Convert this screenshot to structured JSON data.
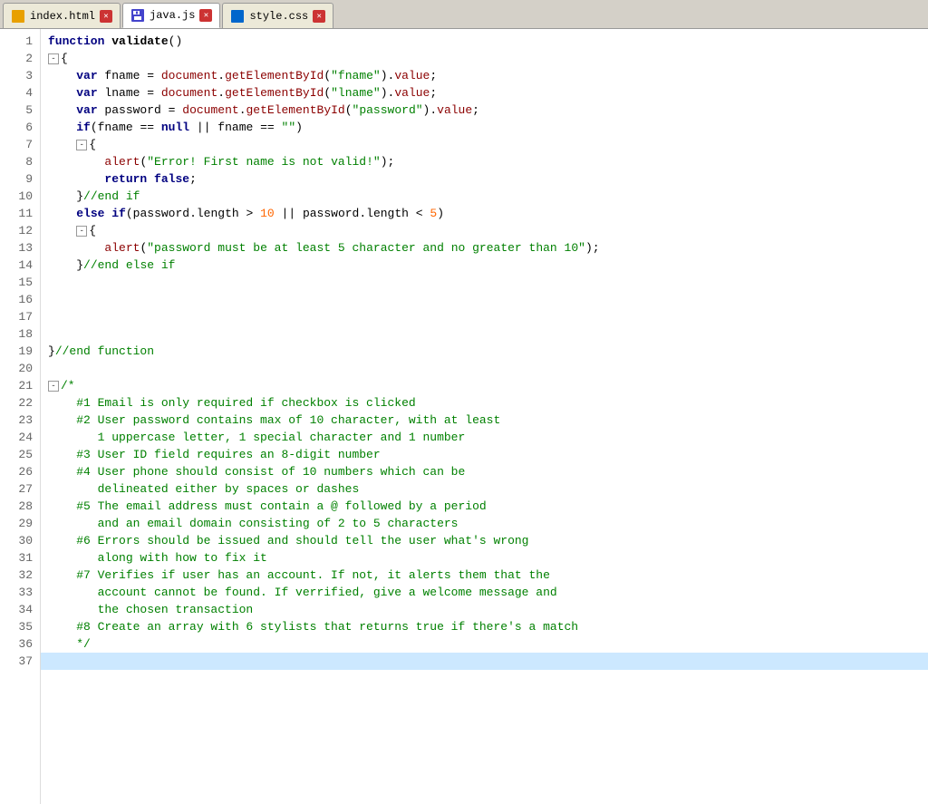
{
  "tabs": [
    {
      "id": "index-html",
      "label": "index.html",
      "icon": "html",
      "active": false,
      "modified": false
    },
    {
      "id": "java-js",
      "label": "java.js",
      "icon": "js",
      "active": true,
      "modified": true
    },
    {
      "id": "style-css",
      "label": "style.css",
      "icon": "css",
      "active": false,
      "modified": false
    }
  ],
  "lines": [
    {
      "num": 1,
      "indent": 0,
      "fold": null,
      "content": "function_validate_open"
    },
    {
      "num": 2,
      "indent": 0,
      "fold": "minus",
      "content": "open_brace"
    },
    {
      "num": 3,
      "indent": 2,
      "fold": null,
      "content": "var_fname"
    },
    {
      "num": 4,
      "indent": 2,
      "fold": null,
      "content": "var_lname"
    },
    {
      "num": 5,
      "indent": 2,
      "fold": null,
      "content": "var_password"
    },
    {
      "num": 6,
      "indent": 2,
      "fold": null,
      "content": "if_fname_null"
    },
    {
      "num": 7,
      "indent": 2,
      "fold": "minus",
      "content": "open_brace2"
    },
    {
      "num": 8,
      "indent": 3,
      "fold": null,
      "content": "alert_fname"
    },
    {
      "num": 9,
      "indent": 3,
      "fold": null,
      "content": "return_false"
    },
    {
      "num": 10,
      "indent": 2,
      "fold": null,
      "content": "close_end_if"
    },
    {
      "num": 11,
      "indent": 2,
      "fold": null,
      "content": "else_if_password"
    },
    {
      "num": 12,
      "indent": 2,
      "fold": "minus",
      "content": "open_brace3"
    },
    {
      "num": 13,
      "indent": 3,
      "fold": null,
      "content": "alert_password"
    },
    {
      "num": 14,
      "indent": 2,
      "fold": null,
      "content": "close_end_else_if"
    },
    {
      "num": 15,
      "indent": 0,
      "fold": null,
      "content": "empty"
    },
    {
      "num": 16,
      "indent": 0,
      "fold": null,
      "content": "empty"
    },
    {
      "num": 17,
      "indent": 0,
      "fold": null,
      "content": "empty"
    },
    {
      "num": 18,
      "indent": 0,
      "fold": null,
      "content": "empty"
    },
    {
      "num": 19,
      "indent": 0,
      "fold": null,
      "content": "close_end_function"
    },
    {
      "num": 20,
      "indent": 0,
      "fold": null,
      "content": "empty"
    },
    {
      "num": 21,
      "indent": 0,
      "fold": "minus",
      "content": "comment_open"
    },
    {
      "num": 22,
      "indent": 1,
      "fold": null,
      "content": "comment_1"
    },
    {
      "num": 23,
      "indent": 1,
      "fold": null,
      "content": "comment_2a"
    },
    {
      "num": 24,
      "indent": 2,
      "fold": null,
      "content": "comment_2b"
    },
    {
      "num": 25,
      "indent": 1,
      "fold": null,
      "content": "comment_3"
    },
    {
      "num": 26,
      "indent": 1,
      "fold": null,
      "content": "comment_4a"
    },
    {
      "num": 27,
      "indent": 2,
      "fold": null,
      "content": "comment_4b"
    },
    {
      "num": 28,
      "indent": 1,
      "fold": null,
      "content": "comment_5a"
    },
    {
      "num": 29,
      "indent": 2,
      "fold": null,
      "content": "comment_5b"
    },
    {
      "num": 30,
      "indent": 1,
      "fold": null,
      "content": "comment_6a"
    },
    {
      "num": 31,
      "indent": 2,
      "fold": null,
      "content": "comment_6b"
    },
    {
      "num": 32,
      "indent": 1,
      "fold": null,
      "content": "comment_7a"
    },
    {
      "num": 33,
      "indent": 2,
      "fold": null,
      "content": "comment_7b"
    },
    {
      "num": 34,
      "indent": 2,
      "fold": null,
      "content": "comment_7c"
    },
    {
      "num": 35,
      "indent": 1,
      "fold": null,
      "content": "comment_8"
    },
    {
      "num": 36,
      "indent": 0,
      "fold": null,
      "content": "comment_close"
    },
    {
      "num": 37,
      "indent": 0,
      "fold": null,
      "content": "empty_last"
    }
  ]
}
